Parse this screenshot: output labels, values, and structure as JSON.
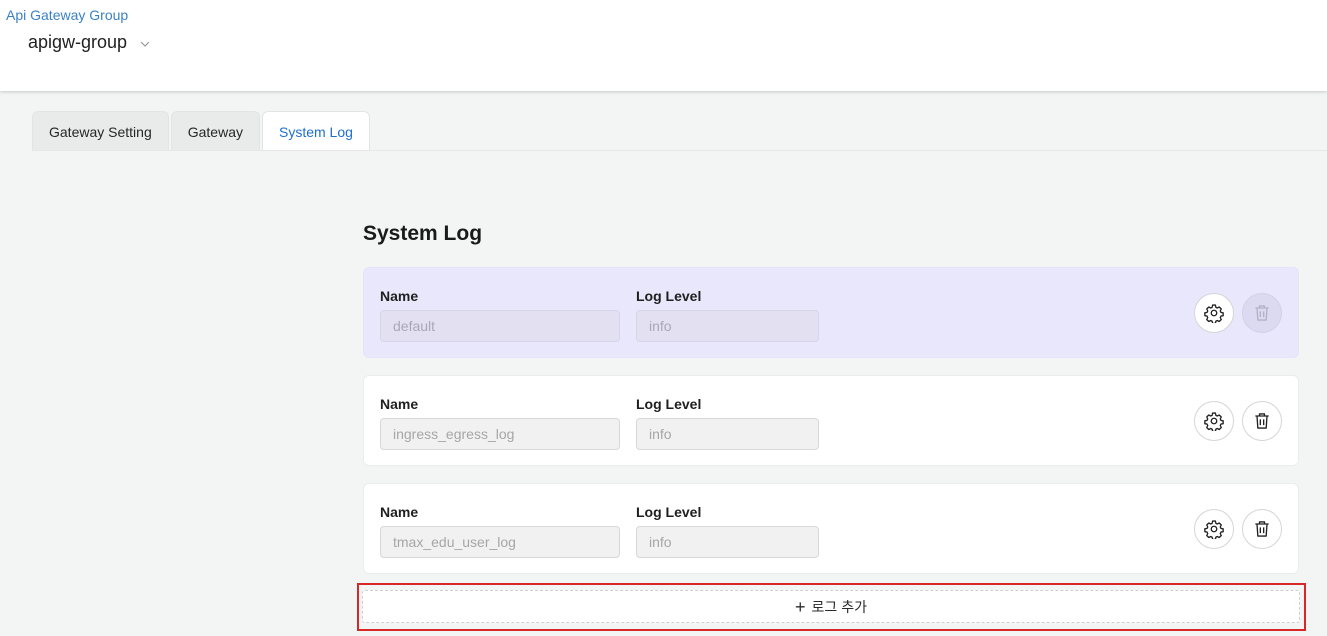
{
  "header": {
    "breadcrumb": "Api Gateway Group",
    "group_name": "apigw-group"
  },
  "tabs": [
    {
      "label": "Gateway Setting",
      "active": false
    },
    {
      "label": "Gateway",
      "active": false
    },
    {
      "label": "System Log",
      "active": true
    }
  ],
  "section": {
    "title": "System Log",
    "name_label": "Name",
    "level_label": "Log Level"
  },
  "logs": [
    {
      "name": "default",
      "level": "info",
      "selected": true,
      "delete_disabled": true
    },
    {
      "name": "ingress_egress_log",
      "level": "info",
      "selected": false,
      "delete_disabled": false
    },
    {
      "name": "tmax_edu_user_log",
      "level": "info",
      "selected": false,
      "delete_disabled": false
    }
  ],
  "add_button": {
    "label": "로그 추가",
    "icon": "plus-icon"
  },
  "colors": {
    "accent": "#1f6fd1",
    "breadcrumb": "#3b82c4",
    "selected_card": "#e9e7fb",
    "highlight": "#d92727"
  }
}
